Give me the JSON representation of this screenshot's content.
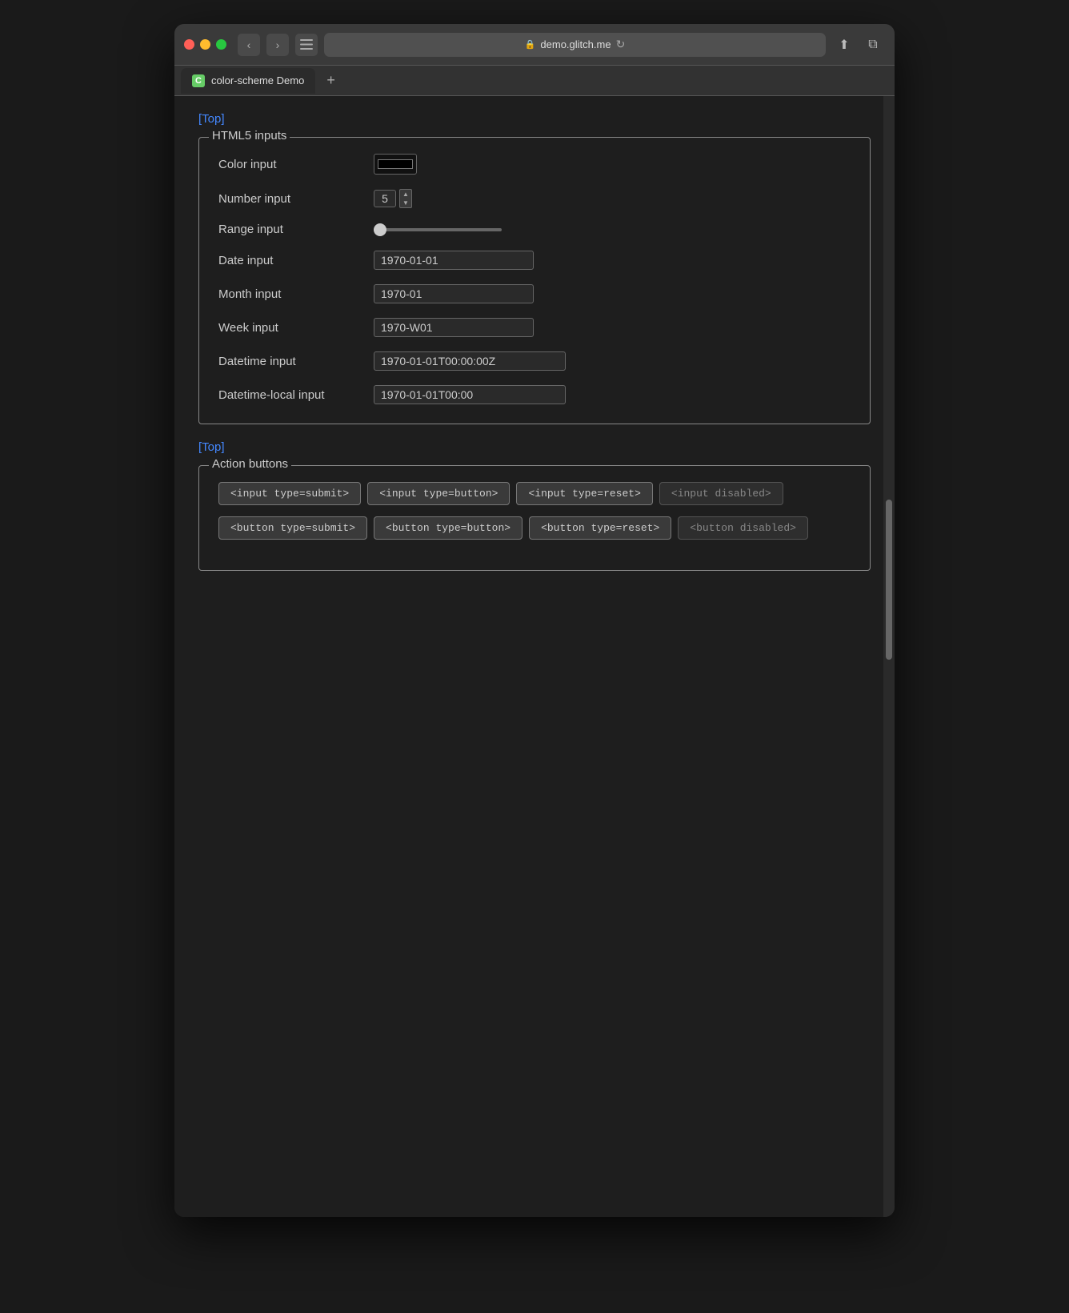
{
  "browser": {
    "url": "demo.glitch.me",
    "tab_title": "color-scheme Demo",
    "tab_favicon": "C",
    "back_btn": "‹",
    "forward_btn": "›",
    "new_tab_btn": "+"
  },
  "top_links": [
    {
      "label": "[Top]",
      "href": "#top"
    },
    {
      "label": "[Top]",
      "href": "#top2"
    }
  ],
  "html5_section": {
    "legend": "HTML5 inputs",
    "fields": [
      {
        "label": "Color input",
        "type": "color",
        "value": "#000000"
      },
      {
        "label": "Number input",
        "type": "number",
        "value": "5"
      },
      {
        "label": "Range input",
        "type": "range",
        "value": "0"
      },
      {
        "label": "Date input",
        "type": "date",
        "value": "1970-01-01"
      },
      {
        "label": "Month input",
        "type": "month",
        "value": "1970-01"
      },
      {
        "label": "Week input",
        "type": "week",
        "value": "1970-W01"
      },
      {
        "label": "Datetime input",
        "type": "datetime",
        "value": "1970-01-01T00:00:00Z"
      },
      {
        "label": "Datetime-local input",
        "type": "datetime-local",
        "value": "1970-01-01T00:00"
      }
    ]
  },
  "action_section": {
    "legend": "Action buttons",
    "input_buttons": [
      {
        "label": "<input type=submit>",
        "type": "submit",
        "disabled": false
      },
      {
        "label": "<input type=button>",
        "type": "button",
        "disabled": false
      },
      {
        "label": "<input type=reset>",
        "type": "reset",
        "disabled": false
      },
      {
        "label": "<input disabled>",
        "type": "button",
        "disabled": true
      }
    ],
    "button_elements": [
      {
        "label": "<button type=submit>",
        "type": "submit",
        "disabled": false
      },
      {
        "label": "<button type=button>",
        "type": "button",
        "disabled": false
      },
      {
        "label": "<button type=reset>",
        "type": "reset",
        "disabled": false
      },
      {
        "label": "<button disabled>",
        "type": "button",
        "disabled": true
      }
    ]
  }
}
